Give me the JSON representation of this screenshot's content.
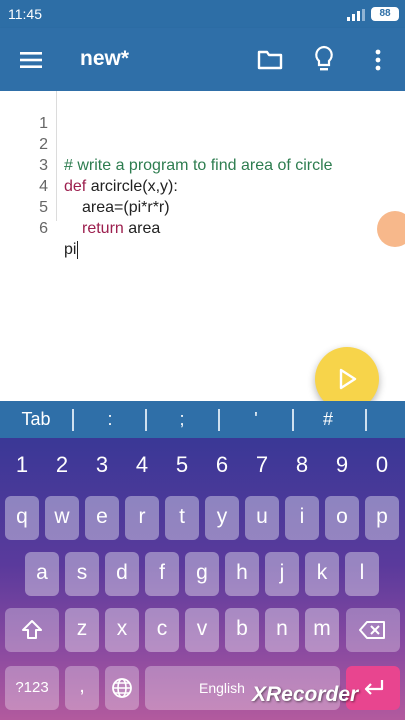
{
  "status": {
    "time": "11:45",
    "battery": "88"
  },
  "toolbar": {
    "title": "new*"
  },
  "editor": {
    "lines": [
      {
        "num": "1",
        "text": ""
      },
      {
        "num": "2",
        "text": "# write a program to find area of circle"
      },
      {
        "num": "3",
        "kw": "def",
        "text": " arcircle(x,y):"
      },
      {
        "num": "4",
        "text": "area=(pi*r*r)"
      },
      {
        "num": "5",
        "kw": "return",
        "text": " area"
      },
      {
        "num": "6",
        "text": "pi"
      }
    ]
  },
  "symbols": [
    "Tab",
    ":",
    ";",
    "'",
    "#"
  ],
  "keyboard": {
    "numbers": [
      "1",
      "2",
      "3",
      "4",
      "5",
      "6",
      "7",
      "8",
      "9",
      "0"
    ],
    "row1": [
      "q",
      "w",
      "e",
      "r",
      "t",
      "y",
      "u",
      "i",
      "o",
      "p"
    ],
    "row2": [
      "a",
      "s",
      "d",
      "f",
      "g",
      "h",
      "j",
      "k",
      "l"
    ],
    "row3": [
      "z",
      "x",
      "c",
      "v",
      "b",
      "n",
      "m"
    ],
    "symbols_key": "?123",
    "comma": ",",
    "space_label": "English",
    "watermark": "XRecorder"
  },
  "colors": {
    "toolbar": "#2f6fa8",
    "run_button": "#f7d44a",
    "comment": "#2e7d50",
    "keyword": "#9c1f4e"
  }
}
